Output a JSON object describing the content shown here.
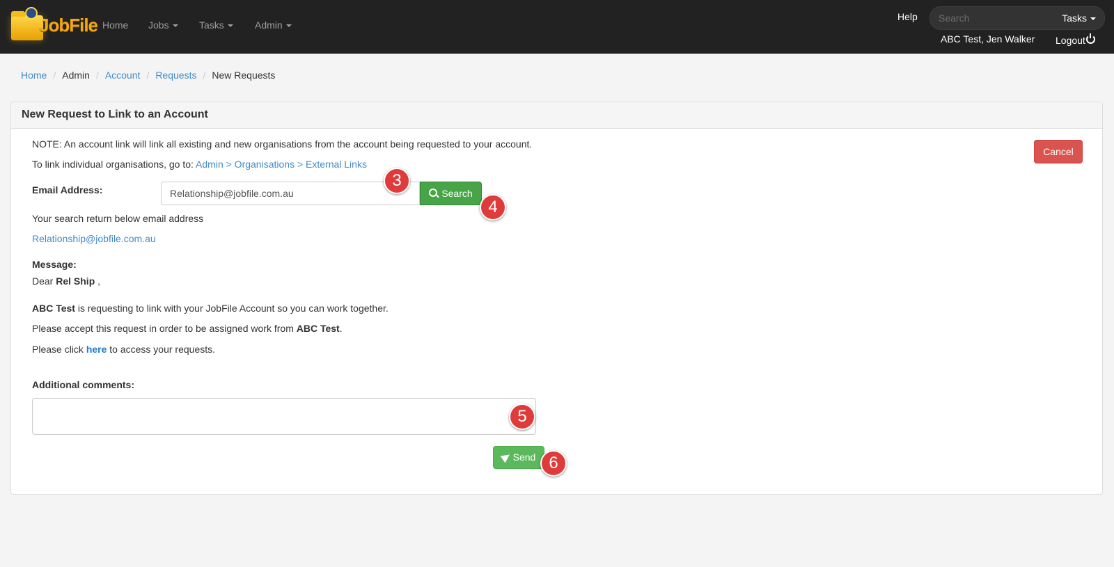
{
  "navbar": {
    "logo_text": "JobFile",
    "items": [
      {
        "label": "Home"
      },
      {
        "label": "Jobs"
      },
      {
        "label": "Tasks"
      },
      {
        "label": "Admin"
      }
    ],
    "help_label": "Help",
    "search_placeholder": "Search",
    "search_dropdown_label": "Tasks",
    "user_name": "ABC Test, Jen Walker",
    "logout_label": "Logout"
  },
  "breadcrumb": [
    "Home",
    "Admin",
    "Account",
    "Requests",
    "New Requests"
  ],
  "panel": {
    "title": "New Request to Link to an Account",
    "note": "NOTE: An account link will link all existing and new organisations from the account being requested to your account.",
    "link_intro": "To link individual organisations, go to: ",
    "link_path": "Admin > Organisations > External Links",
    "cancel_label": "Cancel",
    "email_label": "Email Address:",
    "email_value": "Relationship@jobfile.com.au",
    "search_label": "Search",
    "result_intro": "Your search return below email address",
    "result_email": "Relationship@jobfile.com.au",
    "message_label": "Message:",
    "dear_prefix": "Dear ",
    "recipient_name": "Rel Ship",
    "dear_suffix": " ,",
    "requester_name": "ABC Test",
    "line1_rest": " is requesting to link with your JobFile Account so you can work together.",
    "line2_prefix": "Please accept this request in order to be assigned work from ",
    "line2_suffix": ".",
    "line3_prefix": "Please click ",
    "line3_link": "here",
    "line3_suffix": " to access your requests.",
    "comments_label": "Additional comments:",
    "comments_value": "",
    "send_label": "Send"
  },
  "callouts": [
    "3",
    "4",
    "5",
    "6"
  ],
  "colors": {
    "navbar_bg": "#222222",
    "link": "#428bca",
    "cancel": "#d9534f",
    "search_btn": "#47a447",
    "send_btn": "#5cb85c",
    "callout": "#e03b3b"
  }
}
